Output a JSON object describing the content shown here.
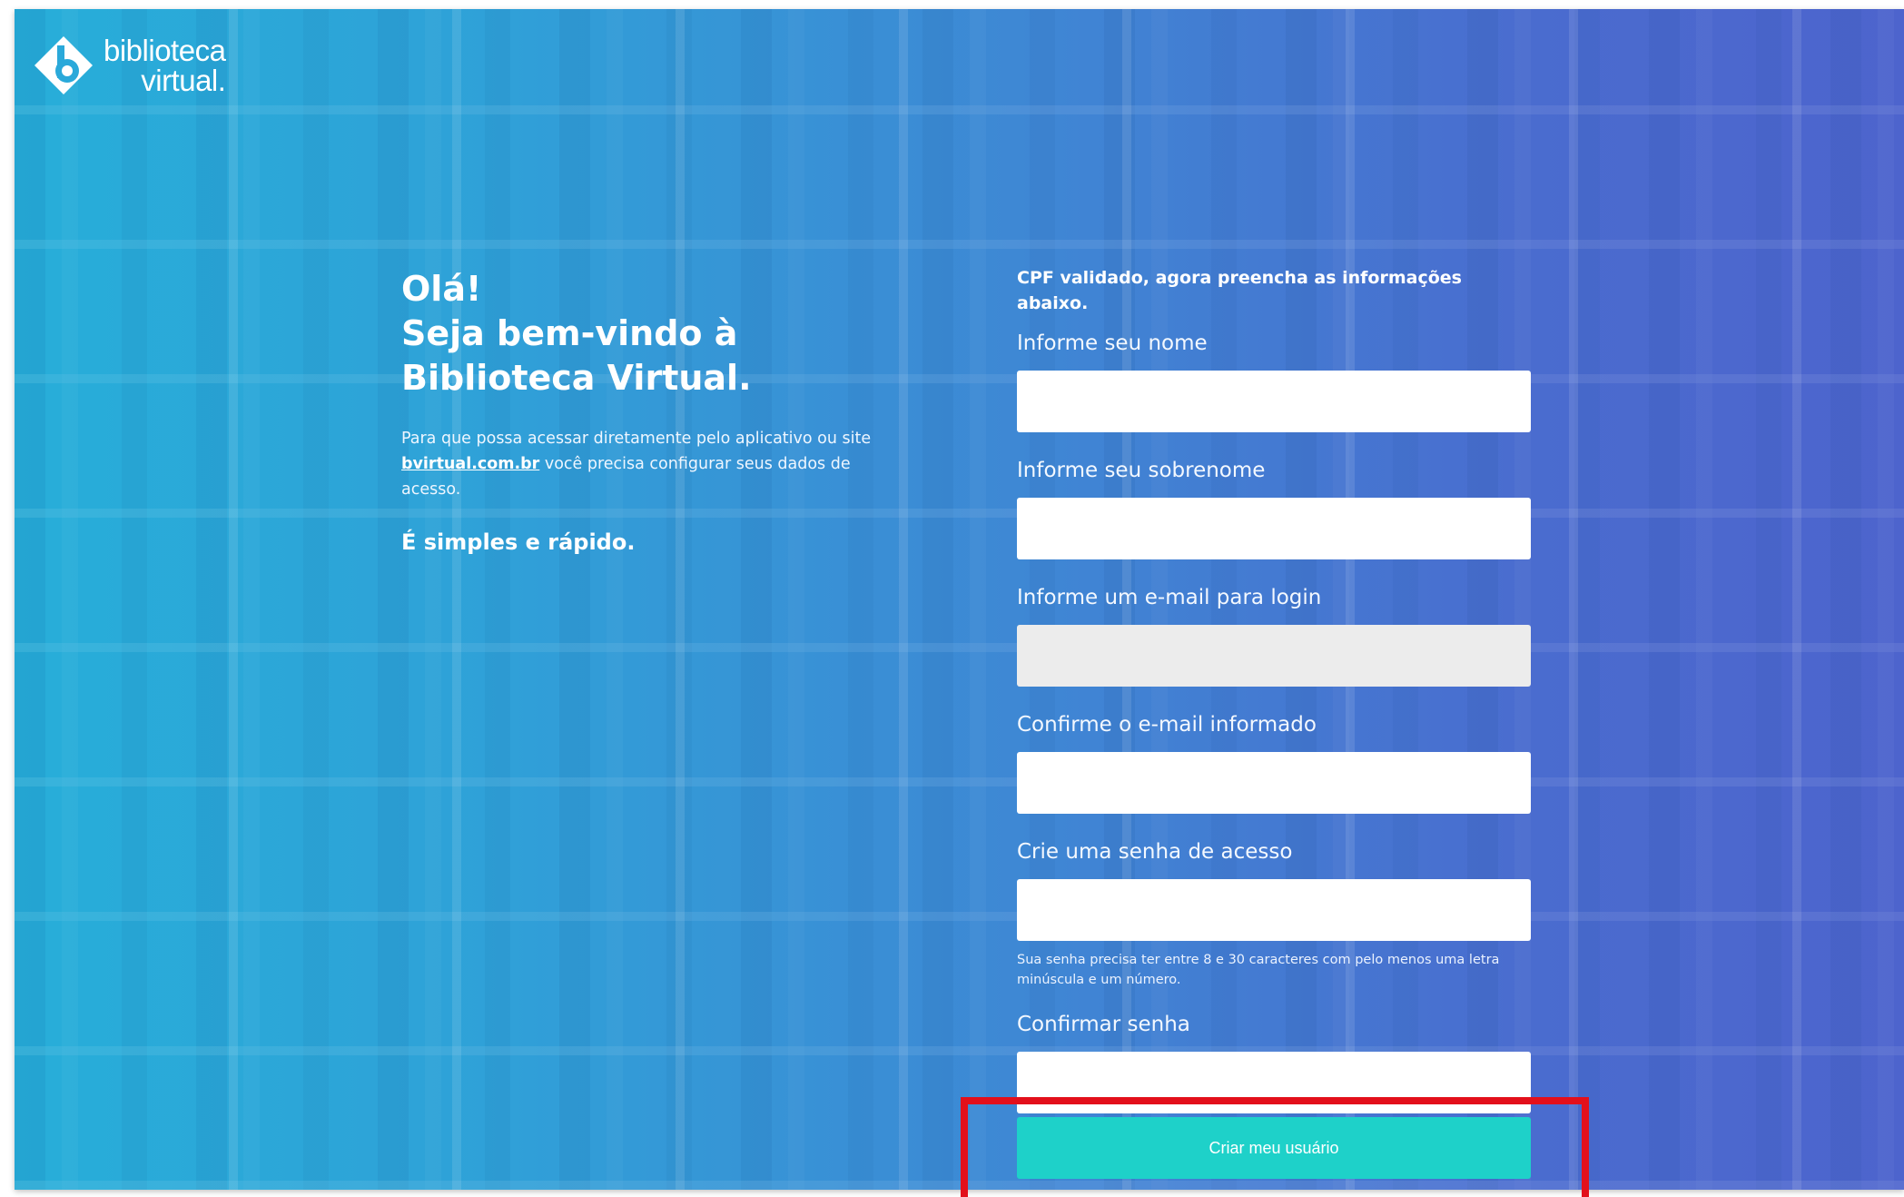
{
  "brand": {
    "line1": "biblioteca",
    "line2": "virtual."
  },
  "welcome": {
    "line1": "Olá!",
    "line2": "Seja bem-vindo à",
    "line3": "Biblioteca Virtual.",
    "intro_before": "Para que possa acessar diretamente pelo aplicativo ou site ",
    "intro_link": "bvirtual.com.br",
    "intro_after": " você precisa configurar seus dados de acesso.",
    "tagline": "É simples e rápido."
  },
  "form": {
    "notice": "CPF validado, agora preencha as informações abaixo.",
    "first_name_label": "Informe seu nome",
    "last_name_label": "Informe seu sobrenome",
    "email_label": "Informe um e-mail para login",
    "confirm_email_label": "Confirme o e-mail informado",
    "password_label": "Crie uma senha de acesso",
    "password_hint": "Sua senha precisa ter entre 8 e 30 caracteres com pelo menos uma letra minúscula e um número.",
    "confirm_password_label": "Confirmar senha",
    "submit_label": "Criar meu usuário"
  },
  "colors": {
    "accent_button": "#1ed1c9",
    "highlight_box": "#e3101b",
    "gradient_start": "#27aed9",
    "gradient_end": "#4d64cd"
  }
}
